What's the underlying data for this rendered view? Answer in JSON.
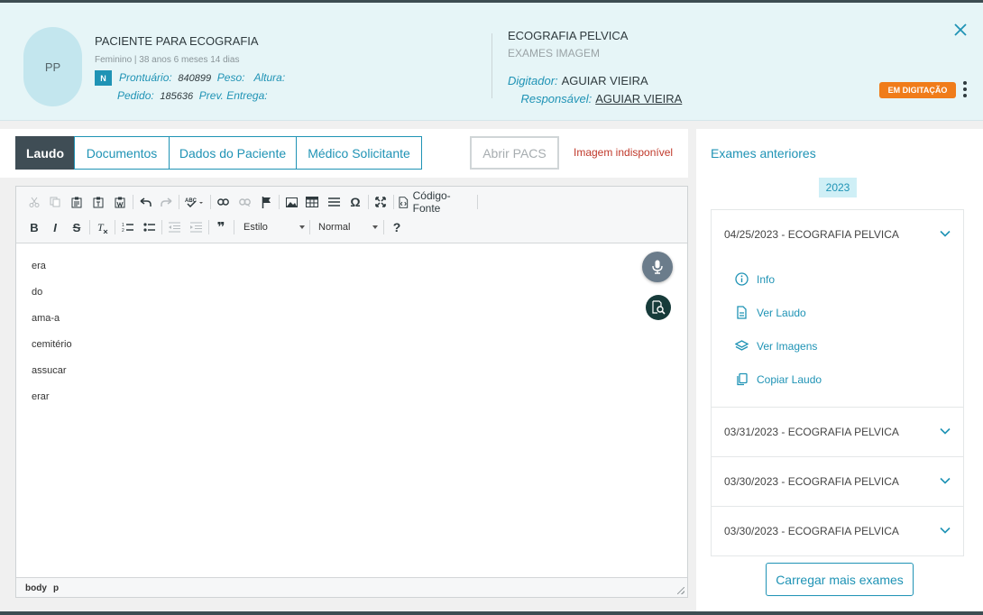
{
  "patient": {
    "initials": "PP",
    "name": "PACIENTE PARA ECOGRAFIA",
    "info": "Feminino | 38 anos 6 meses 14 dias",
    "badge": "N",
    "prontuario_label": "Prontuário:",
    "prontuario": "840899",
    "peso_label": "Peso:",
    "altura_label": "Altura:",
    "pedido_label": "Pedido:",
    "pedido": "185636",
    "prev_label": "Prev. Entrega:"
  },
  "exam": {
    "name": "ECOGRAFIA PELVICA",
    "category": "EXAMES IMAGEM",
    "digitador_label": "Digitador:",
    "digitador": "AGUIAR VIEIRA",
    "responsavel_label": "Responsável:",
    "responsavel": "AGUIAR VIEIRA",
    "status": "EM DIGITAÇÃO"
  },
  "tabs": [
    {
      "label": "Laudo"
    },
    {
      "label": "Documentos"
    },
    {
      "label": "Dados do Paciente"
    },
    {
      "label": "Médico Solicitante"
    }
  ],
  "pacs_label": "Abrir PACS",
  "image_unavailable": "Imagem indisponível",
  "toolbar": {
    "source_label": "Código-Fonte",
    "style_label": "Estilo",
    "format_label": "Normal",
    "bold": "B",
    "italic": "I",
    "strike": "S",
    "help": "?",
    "quote": "❞",
    "omega": "Ω"
  },
  "editor_lines": [
    "era",
    "do",
    "ama-a",
    "cemitério",
    "assucar",
    "erar"
  ],
  "statusbar": [
    "body",
    "p"
  ],
  "previous": {
    "title": "Exames anteriores",
    "year": "2023",
    "items": [
      {
        "label": "04/25/2023 - ECOGRAFIA PELVICA"
      },
      {
        "label": "03/31/2023 - ECOGRAFIA PELVICA"
      },
      {
        "label": "03/30/2023 - ECOGRAFIA PELVICA"
      },
      {
        "label": "03/30/2023 - ECOGRAFIA PELVICA"
      }
    ],
    "actions": [
      {
        "label": "Info",
        "icon": "info-icon"
      },
      {
        "label": "Ver Laudo",
        "icon": "document-icon"
      },
      {
        "label": "Ver Imagens",
        "icon": "layers-icon"
      },
      {
        "label": "Copiar Laudo",
        "icon": "copy-icon"
      }
    ],
    "load_more": "Carregar mais exames"
  },
  "colors": {
    "accent": "#1f93b5",
    "status": "#f07c1a",
    "active_tab": "#3f4d55",
    "header_bg": "#e6f5f7"
  }
}
